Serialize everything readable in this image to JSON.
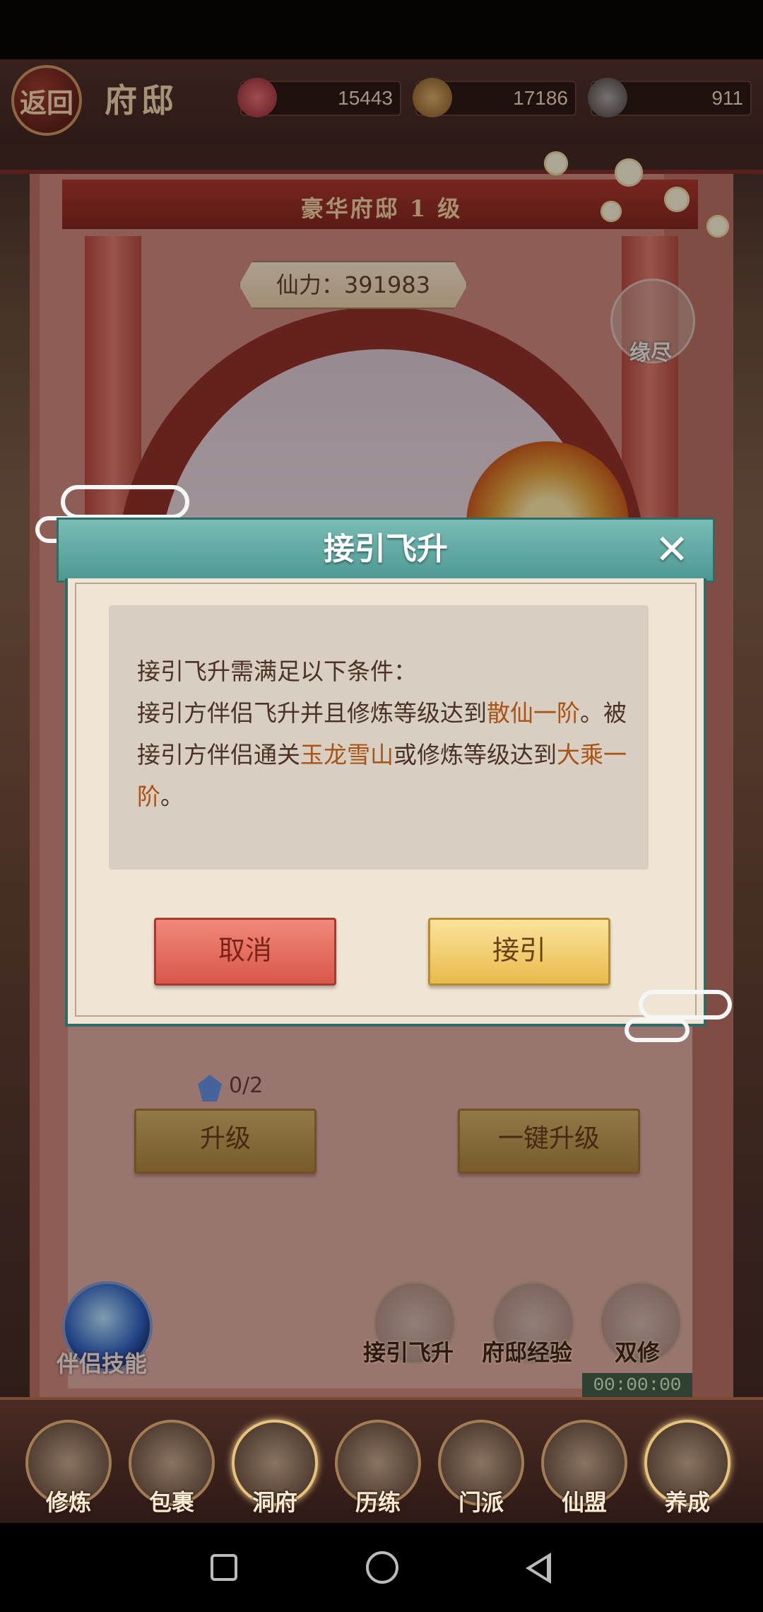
{
  "header": {
    "back_label": "返回",
    "title": "府邸",
    "resources": [
      {
        "icon": "meat-icon",
        "value": "15443"
      },
      {
        "icon": "wood-icon",
        "value": "17186"
      },
      {
        "icon": "ore-icon",
        "value": "911"
      }
    ]
  },
  "scene": {
    "level_title": "豪华府邸 1 级",
    "power_label": "仙力：391983",
    "broken_label": "缘尽"
  },
  "dialog": {
    "title": "接引飞升",
    "line1": "接引飞升需满足以下条件：",
    "part_a": "接引方伴侣飞升并且修炼等级达到",
    "hl_1": "散仙一阶",
    "part_b": "。被接引方伴侣通关",
    "hl_2": "玉龙雪山",
    "part_c": "或修炼等级达到",
    "hl_3": "大乘一阶",
    "part_d": "。",
    "cancel_label": "取消",
    "confirm_label": "接引"
  },
  "upgrade": {
    "gem_count": "0/2",
    "upgrade_label": "升级",
    "one_click_label": "一键升级"
  },
  "actions": {
    "skill_label": "伴侣技能",
    "ascend_label": "接引飞升",
    "exp_label": "府邸经验",
    "dual_label": "双修",
    "timer": "00:00:00"
  },
  "nav": [
    {
      "label": "修炼"
    },
    {
      "label": "包裹"
    },
    {
      "label": "洞府"
    },
    {
      "label": "历练"
    },
    {
      "label": "门派"
    },
    {
      "label": "仙盟"
    },
    {
      "label": "养成"
    }
  ],
  "colors": {
    "dialog_header": "#5aa39c",
    "highlight": "#a75416",
    "cancel_btn": "#e46a5c",
    "confirm_btn": "#f1cf72"
  }
}
